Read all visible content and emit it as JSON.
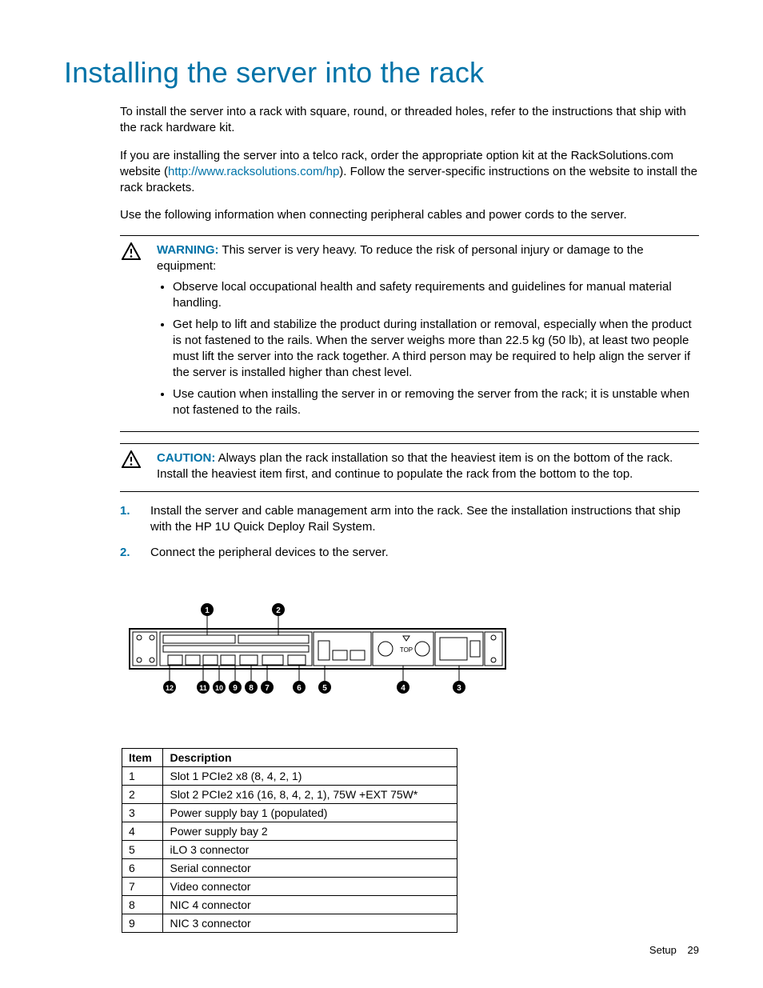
{
  "heading": "Installing the server into the rack",
  "para1": "To install the server into a rack with square, round, or threaded holes, refer to the instructions that ship with the rack hardware kit.",
  "para2a": "If you are installing the server into a telco rack, order the appropriate option kit at the RackSolutions.com website (",
  "link": "http://www.racksolutions.com/hp",
  "para2b": "). Follow the server-specific instructions on the website to install the rack brackets.",
  "para3": "Use the following information when connecting peripheral cables and power cords to the server.",
  "warning": {
    "label": "WARNING:",
    "lead": "This server is very heavy. To reduce the risk of personal injury or damage to the equipment:",
    "bullets": [
      "Observe local occupational health and safety requirements and guidelines for manual material handling.",
      "Get help to lift and stabilize the product during installation or removal, especially when the product is not fastened to the rails. When the server weighs more than 22.5 kg (50 lb), at least two people must lift the server into the rack together. A third person may be required to help align the server if the server is installed higher than chest level.",
      "Use caution when installing the server in or removing the server from the rack; it is unstable when not fastened to the rails."
    ]
  },
  "caution": {
    "label": "CAUTION:",
    "text": "Always plan the rack installation so that the heaviest item is on the bottom of the rack. Install the heaviest item first, and continue to populate the rack from the bottom to the top."
  },
  "steps": [
    "Install the server and cable management arm into the rack. See the installation instructions that ship with the HP 1U Quick Deploy Rail System.",
    "Connect the peripheral devices to the server."
  ],
  "diagram_callouts": [
    "1",
    "2",
    "3",
    "4",
    "5",
    "6",
    "7",
    "8",
    "9",
    "10",
    "11",
    "12"
  ],
  "diagram_top_label": "TOP",
  "table": {
    "headers": [
      "Item",
      "Description"
    ],
    "rows": [
      [
        "1",
        "Slot 1 PCIe2 x8 (8, 4, 2, 1)"
      ],
      [
        "2",
        "Slot 2 PCIe2 x16 (16, 8, 4, 2, 1), 75W +EXT 75W*"
      ],
      [
        "3",
        "Power supply bay 1 (populated)"
      ],
      [
        "4",
        "Power supply bay 2"
      ],
      [
        "5",
        "iLO 3 connector"
      ],
      [
        "6",
        "Serial connector"
      ],
      [
        "7",
        "Video connector"
      ],
      [
        "8",
        "NIC 4 connector"
      ],
      [
        "9",
        "NIC 3 connector"
      ]
    ]
  },
  "footer": {
    "section": "Setup",
    "page": "29"
  }
}
